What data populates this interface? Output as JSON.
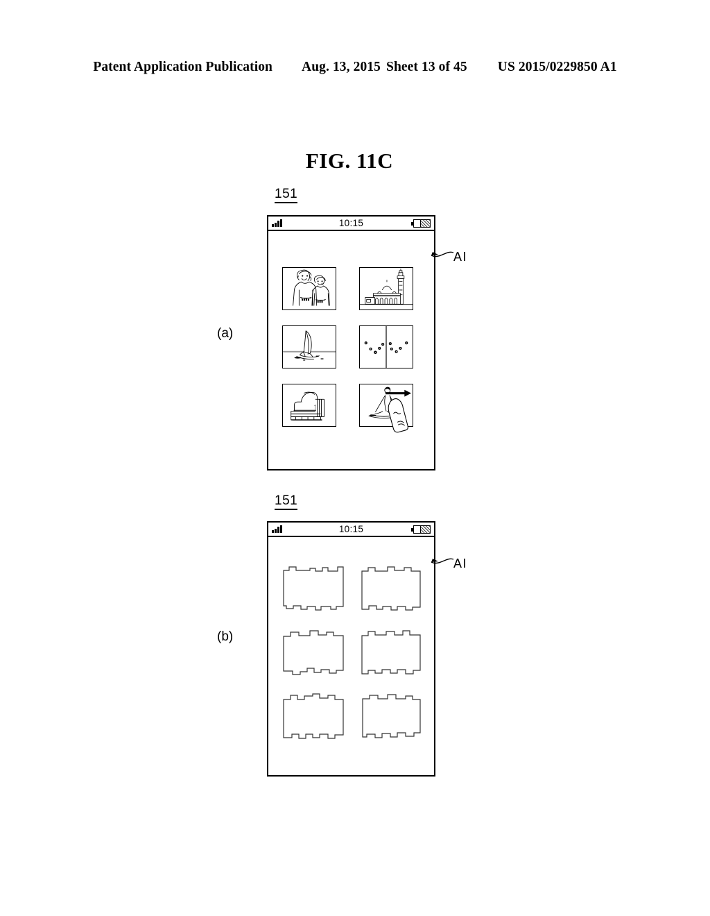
{
  "header": {
    "publication": "Patent Application Publication",
    "date": "Aug. 13, 2015",
    "sheet": "Sheet 13 of 45",
    "patent_number": "US 2015/0229850 A1"
  },
  "figure": {
    "title": "FIG. 11C"
  },
  "panels": [
    {
      "letter": "(a)",
      "reference_number": "151",
      "callout_label": "AI",
      "status_bar": {
        "time": "10:15",
        "signal_icon": "signal-bars-icon",
        "battery_icon": "battery-icon"
      },
      "thumbnails": [
        {
          "name": "two-people-portrait",
          "alt": "Two people portrait photo"
        },
        {
          "name": "mosque-minaret",
          "alt": "Mosque with dome and minaret"
        },
        {
          "name": "windsurfer",
          "alt": "Windsurfer on water"
        },
        {
          "name": "night-sky-dots",
          "alt": "Two-pane photo of dots in the sky"
        },
        {
          "name": "sofa-furniture",
          "alt": "Sofa with cushions"
        },
        {
          "name": "skier-with-drag-gesture",
          "alt": "Skier photo with finger drag gesture and right arrow"
        }
      ],
      "gesture": {
        "type": "drag-right",
        "on_thumbnail": "skier-with-drag-gesture"
      }
    },
    {
      "letter": "(b)",
      "reference_number": "151",
      "callout_label": "AI",
      "status_bar": {
        "time": "10:15",
        "signal_icon": "signal-bars-icon",
        "battery_icon": "battery-icon"
      },
      "placeholders": [
        {
          "name": "jigsaw-placeholder-1"
        },
        {
          "name": "jigsaw-placeholder-2"
        },
        {
          "name": "jigsaw-placeholder-3"
        },
        {
          "name": "jigsaw-placeholder-4"
        },
        {
          "name": "jigsaw-placeholder-5"
        },
        {
          "name": "jigsaw-placeholder-6"
        }
      ]
    }
  ],
  "colors": {
    "ink": "#000000",
    "paper": "#ffffff"
  }
}
